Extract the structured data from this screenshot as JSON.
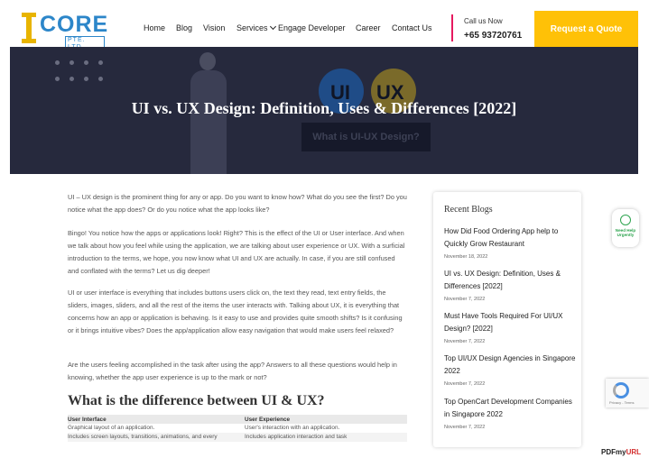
{
  "brand": {
    "logo_word": "CORE",
    "logo_sub": "PTE. LTD.",
    "accent_yellow": "#ffc107",
    "accent_blue": "#2c86c9"
  },
  "nav": {
    "home": "Home",
    "blog": "Blog",
    "vision": "Vision",
    "services": "Services",
    "engage": "Engage Developer",
    "career": "Career",
    "contact": "Contact Us"
  },
  "call": {
    "label": "Call us Now",
    "number": "+65 93720761"
  },
  "quote_button": "Request a Quote",
  "hero": {
    "ui_text": "UI",
    "ux_text": "UX",
    "title": "UI vs. UX Design: Definition, Uses & Differences [2022]",
    "badge": "What is UI-UX Design?"
  },
  "article": {
    "p1": "UI – UX design is the prominent thing for any or app. Do you want to know how? What do you see the first? Do you notice what the app does? Or do you notice what the app looks like?",
    "p2": "Bingo! You notice how the apps or applications look! Right? This is the effect of the UI or User interface. And when we talk about how you feel while using the application, we are talking about user experience or UX. With a surficial introduction to the terms, we hope, you now know what UI and UX are actually. In case, if you are still confused and conflated with the terms? Let us dig deeper!",
    "p3": "UI or user interface is everything that includes buttons users click on, the text they read, text entry fields, the sliders, images, sliders, and all the rest of the items the user interacts with. Talking about UX, it is everything that concerns how an app or application is behaving. Is it easy to use and provides quite smooth shifts? Is it confusing or it brings intuitive vibes? Does the app/application allow easy navigation that would make users feel relaxed?",
    "p4": "Are the users feeling accomplished in the task after using the app? Answers to all these questions would help in knowing, whether the app user experience is up to the mark or not?",
    "h2": "What is the difference between UI & UX?",
    "table": {
      "headers": [
        "User Interface",
        "User Experience"
      ],
      "rows": [
        [
          "Graphical layout of an application.",
          "User's interaction with an application."
        ],
        [
          "Includes screen layouts, transitions, animations, and every",
          "Includes application interaction and task"
        ]
      ]
    }
  },
  "sidebar": {
    "title": "Recent Blogs",
    "items": [
      {
        "title": "How Did Food Ordering App help to Quickly Grow Restaurant",
        "date": "November 18, 2022"
      },
      {
        "title": "UI vs. UX Design: Definition, Uses & Differences [2022]",
        "date": "November 7, 2022"
      },
      {
        "title": "Must Have Tools Required For UI/UX Design? [2022]",
        "date": "November 7, 2022"
      },
      {
        "title": "Top UI/UX Design Agencies in Singapore 2022",
        "date": "November 7, 2022"
      },
      {
        "title": "Top OpenCart Development Companies in Singapore 2022",
        "date": "November 7, 2022"
      }
    ]
  },
  "widgets": {
    "whatsapp_text": "Need Help Urgently",
    "recaptcha_text": "Privacy - Terms",
    "pdf_left": "PDFmy",
    "pdf_right": "URL"
  }
}
